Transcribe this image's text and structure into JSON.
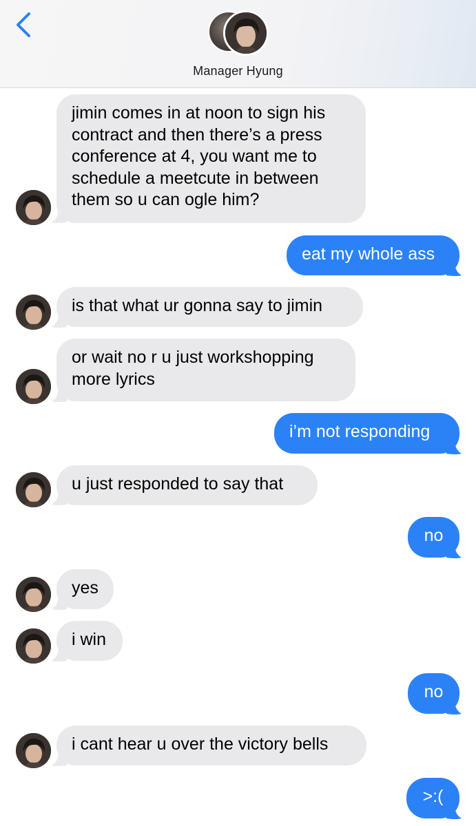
{
  "header": {
    "contact_name": "Manager Hyung",
    "back_icon": "chevron-left-icon",
    "accent_color": "#2b82f6"
  },
  "messages": [
    {
      "from": "them",
      "text": "jimin comes in at noon to sign his\ncontract and then there’s a press\nconference at 4, you want me to\nschedule a meetcute in between\nthem so u can ogle him?"
    },
    {
      "from": "me",
      "text": "eat my whole ass"
    },
    {
      "from": "them",
      "text": "is that what ur gonna say to jimin"
    },
    {
      "from": "them",
      "text": "or wait no r u just workshopping\nmore lyrics"
    },
    {
      "from": "me",
      "text": "i’m not responding"
    },
    {
      "from": "them",
      "text": "u just responded to say that"
    },
    {
      "from": "me",
      "text": "no"
    },
    {
      "from": "them",
      "text": "yes"
    },
    {
      "from": "them",
      "text": "i win"
    },
    {
      "from": "me",
      "text": "no"
    },
    {
      "from": "them",
      "text": "i cant hear u over the victory bells"
    },
    {
      "from": "me",
      "text": ">:("
    }
  ],
  "colors": {
    "incoming_bubble": "#e9e9eb",
    "outgoing_bubble": "#2b82f6"
  }
}
